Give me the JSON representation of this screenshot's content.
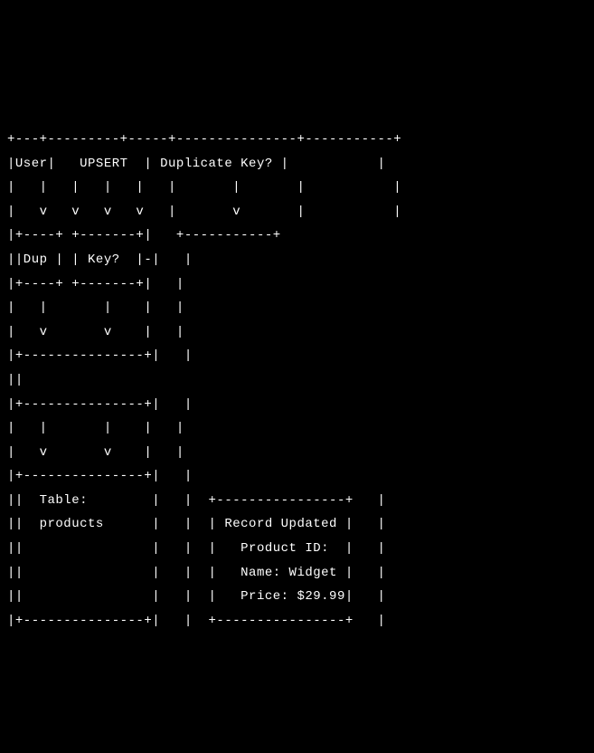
{
  "diagram": {
    "lines": [
      "+---+---------+-----+---------------+-----------+",
      "|User|   UPSERT  | Duplicate Key? |           |",
      "|   |   |   |   |   |       |       |           |",
      "|   v   v   v   v   |       v       |           |",
      "|+----+ +-------+|   +-----------+",
      "||Dup | | Key?  |-|   |",
      "|+----+ +-------+|   |",
      "|   |       |    |   |",
      "|   v       v    |   |",
      "|+---------------+|   |",
      "||               ",
      "|+---------------+|   |",
      "|   |       |    |   |",
      "|   v       v    |   |",
      "|+---------------+|   |",
      "||  Table:        |   |  +----------------+   |",
      "||  products      |   |  | Record Updated |   |",
      "||                |   |  |   Product ID:  |   |",
      "||                |   |  |   Name: Widget |   |",
      "||                |   |  |   Price: $29.99|   |",
      "|+---------------+|   |  +----------------+   |"
    ],
    "labels": {
      "user": "User",
      "upsert": "UPSERT",
      "duplicate_key_q": "Duplicate Key?",
      "dup": "Dup",
      "key_q": "Key?",
      "table_label": "Table:",
      "table_name": "products",
      "record_updated": "Record Updated",
      "product_id": "Product ID:",
      "name_widget": "Name: Widget",
      "price": "Price: $29.99"
    }
  }
}
